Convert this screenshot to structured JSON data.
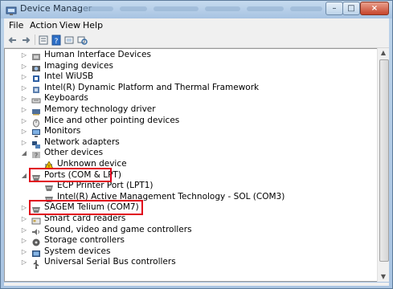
{
  "window": {
    "title": "Device Manager",
    "icon": "device-manager-icon",
    "buttons": {
      "minimize": "–",
      "maximize": "□",
      "close": "×"
    }
  },
  "menu": [
    "File",
    "Action",
    "View",
    "Help"
  ],
  "toolbar": {
    "icons": [
      "back-arrow-icon",
      "forward-arrow-icon",
      "properties-icon",
      "help-icon",
      "scan-hardware-icon"
    ]
  },
  "tree": {
    "items": [
      {
        "label": "Human Interface Devices",
        "icon": "hid-icon",
        "expanded": false,
        "level": 1
      },
      {
        "label": "Imaging devices",
        "icon": "camera-icon",
        "expanded": false,
        "level": 1
      },
      {
        "label": "Intel WiUSB",
        "icon": "usb-icon",
        "expanded": false,
        "level": 1
      },
      {
        "label": "Intel(R) Dynamic Platform and Thermal Framework",
        "icon": "chip-icon",
        "expanded": false,
        "level": 1
      },
      {
        "label": "Keyboards",
        "icon": "keyboard-icon",
        "expanded": false,
        "level": 1
      },
      {
        "label": "Memory technology driver",
        "icon": "memory-icon",
        "expanded": false,
        "level": 1
      },
      {
        "label": "Mice and other pointing devices",
        "icon": "mouse-icon",
        "expanded": false,
        "level": 1
      },
      {
        "label": "Monitors",
        "icon": "monitor-icon",
        "expanded": false,
        "level": 1
      },
      {
        "label": "Network adapters",
        "icon": "network-icon",
        "expanded": false,
        "level": 1
      },
      {
        "label": "Other devices",
        "icon": "other-devices-icon",
        "expanded": true,
        "level": 1
      },
      {
        "label": "Unknown device",
        "icon": "unknown-device-icon",
        "expanded": null,
        "level": 2
      },
      {
        "label": "Ports (COM & LPT)",
        "icon": "port-icon",
        "expanded": true,
        "level": 1
      },
      {
        "label": "ECP Printer Port (LPT1)",
        "icon": "port-icon",
        "expanded": null,
        "level": 2
      },
      {
        "label": "Intel(R) Active Management Technology - SOL (COM3)",
        "icon": "port-icon",
        "expanded": null,
        "level": 2
      },
      {
        "label": "SAGEM Telium (COM7)",
        "icon": "port-icon",
        "expanded": false,
        "level": 1
      },
      {
        "label": "Smart card readers",
        "icon": "smart-card-icon",
        "expanded": false,
        "level": 1
      },
      {
        "label": "Sound, video and game controllers",
        "icon": "speaker-icon",
        "expanded": false,
        "level": 1
      },
      {
        "label": "Storage controllers",
        "icon": "storage-icon",
        "expanded": false,
        "level": 1
      },
      {
        "label": "System devices",
        "icon": "system-icon",
        "expanded": false,
        "level": 1
      },
      {
        "label": "Universal Serial Bus controllers",
        "icon": "usb-controller-icon",
        "expanded": false,
        "level": 1
      }
    ]
  },
  "colors": {
    "highlight": "#e0001a"
  }
}
